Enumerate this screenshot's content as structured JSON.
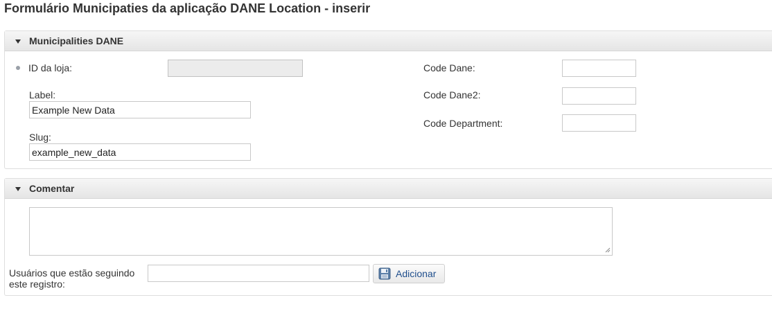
{
  "page": {
    "title": "Formulário Municipaties da aplicação DANE Location - inserir"
  },
  "section_main": {
    "title": "Municipalities DANE",
    "store_id": {
      "label": "ID da loja:",
      "value": ""
    },
    "label_field": {
      "label": "Label:",
      "value": "Example New Data"
    },
    "slug_field": {
      "label": "Slug:",
      "value": "example_new_data"
    },
    "code_dane": {
      "label": "Code Dane:",
      "value": ""
    },
    "code_dane2": {
      "label": "Code Dane2:",
      "value": ""
    },
    "code_department": {
      "label": "Code Department:",
      "value": ""
    }
  },
  "section_comment": {
    "title": "Comentar",
    "comment_value": "",
    "followers_label_line1": "Usuários que estão seguindo",
    "followers_label_line2": "este registro:",
    "followers_value": "",
    "add_button_label": "Adicionar"
  },
  "icons": {
    "collapse": "caret-down-icon",
    "required": "bullet-dot-icon",
    "save": "floppy-disk-icon",
    "resize": "resize-grip-icon"
  },
  "colors": {
    "button_text": "#1f4e8c",
    "header_bg": "#ececec",
    "disabled_field": "#ececec"
  }
}
